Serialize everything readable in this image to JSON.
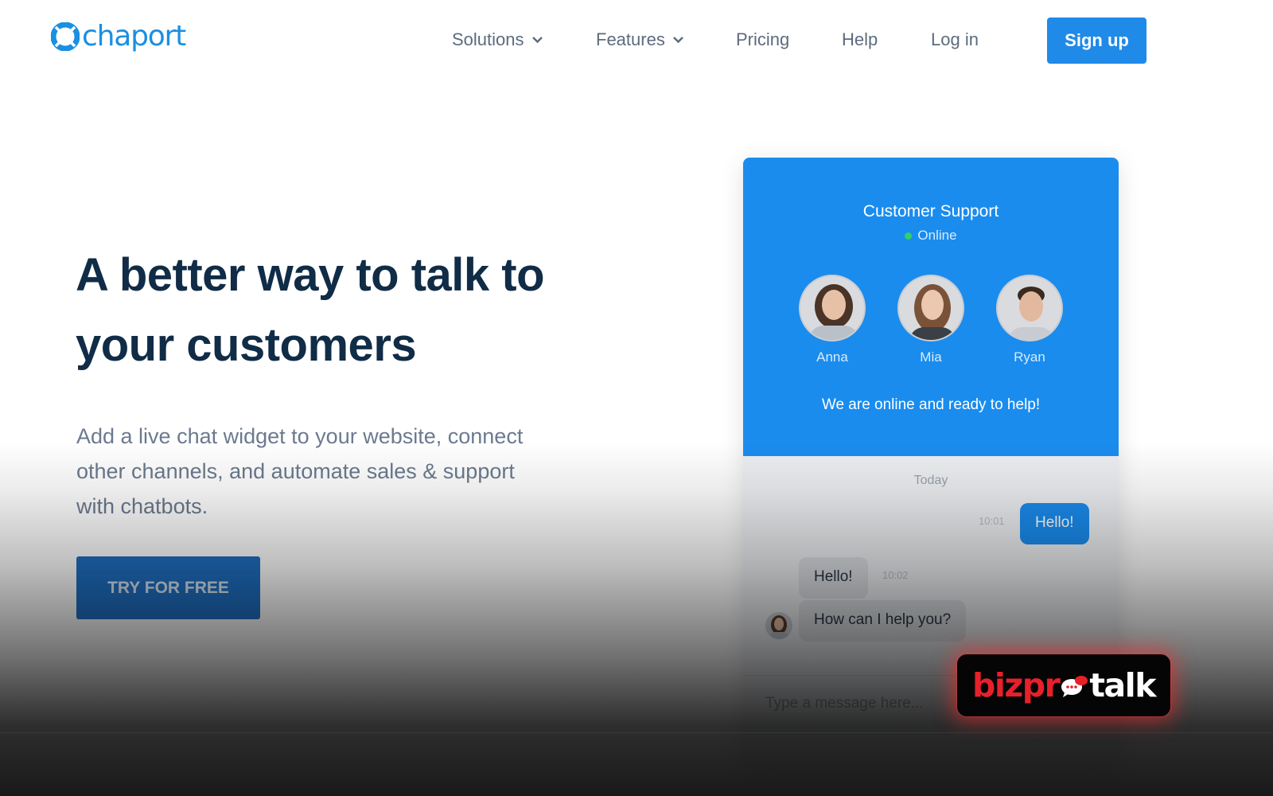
{
  "brand": {
    "name": "chaport",
    "color": "#1a8fe3"
  },
  "nav": {
    "items": [
      {
        "label": "Solutions",
        "has_dropdown": true
      },
      {
        "label": "Features",
        "has_dropdown": true
      },
      {
        "label": "Pricing",
        "has_dropdown": false
      },
      {
        "label": "Help",
        "has_dropdown": false
      },
      {
        "label": "Log in",
        "has_dropdown": false
      }
    ],
    "signup_label": "Sign up"
  },
  "hero": {
    "title_line1": "A better way to talk to",
    "title_line2": "your customers",
    "subtitle_line1": "Add a live chat widget to your website, connect",
    "subtitle_line2": "other channels, and automate sales & support",
    "subtitle_line3": "with chatbots.",
    "cta_label": "TRY FOR FREE"
  },
  "widget": {
    "title": "Customer Support",
    "status": "Online",
    "agents": [
      {
        "name": "Anna"
      },
      {
        "name": "Mia"
      },
      {
        "name": "Ryan"
      }
    ],
    "ready_text": "We are online and ready to help!",
    "day_label": "Today",
    "messages": [
      {
        "direction": "out",
        "text": "Hello!",
        "time": "10:01"
      },
      {
        "direction": "in",
        "text": "Hello!",
        "time": "10:02"
      },
      {
        "direction": "in",
        "text": "How can I help you?",
        "time": ""
      }
    ],
    "input_placeholder": "Type a message here..."
  },
  "badge": {
    "part1": "bizpr",
    "part2": "talk"
  },
  "colors": {
    "primary": "#1f8ae8",
    "widget_header": "#1a8cee",
    "heading": "#102c46",
    "online": "#2fd16b"
  }
}
